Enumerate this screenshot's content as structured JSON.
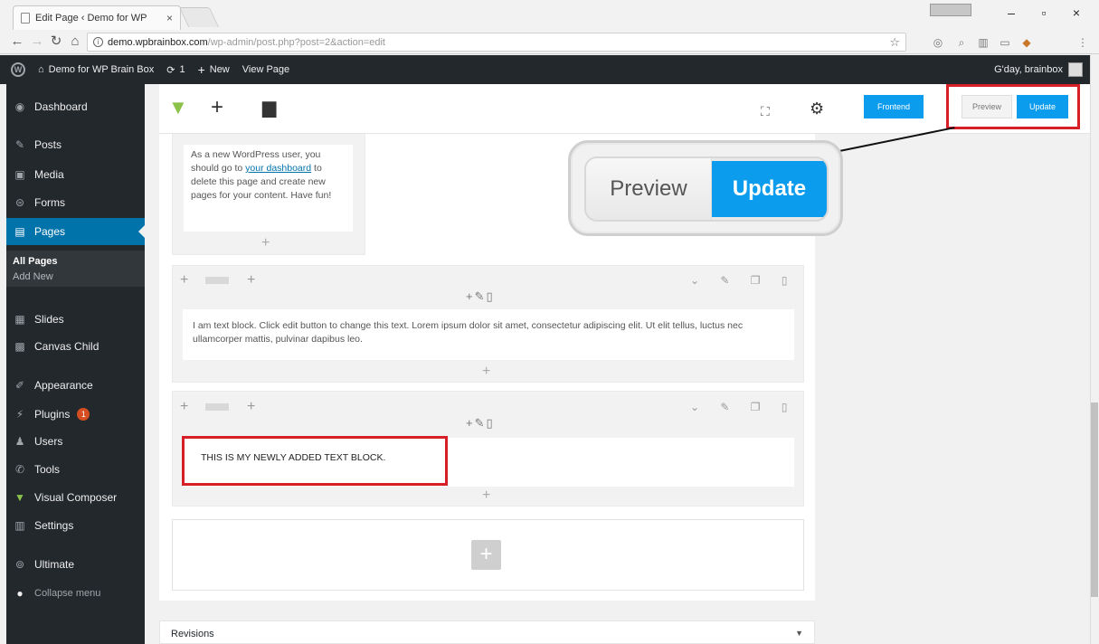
{
  "browser": {
    "tab_title": "Edit Page ‹ Demo for WP",
    "tab_close": "×",
    "url_host": "demo.wpbrainbox.com",
    "url_path": "/wp-admin/post.php?post=2&action=edit",
    "user_badge": "",
    "window_minimize": "–",
    "window_maximize": "▫",
    "window_close": "×"
  },
  "adminbar": {
    "site_name": "Demo for WP Brain Box",
    "updates_count": "1",
    "new_label": "New",
    "view_page": "View Page",
    "greeting": "G'day, brainbox"
  },
  "sidebar": {
    "items": [
      {
        "label": "Dashboard",
        "icon": "dashboard-icon"
      },
      {
        "label": "Posts",
        "icon": "pin-icon"
      },
      {
        "label": "Media",
        "icon": "media-icon"
      },
      {
        "label": "Forms",
        "icon": "forms-icon"
      },
      {
        "label": "Pages",
        "icon": "pages-icon"
      },
      {
        "label": "Slides",
        "icon": "slides-icon"
      },
      {
        "label": "Canvas Child",
        "icon": "canvas-icon"
      },
      {
        "label": "Appearance",
        "icon": "brush-icon"
      },
      {
        "label": "Plugins",
        "icon": "plug-icon",
        "badge": "1"
      },
      {
        "label": "Users",
        "icon": "users-icon"
      },
      {
        "label": "Tools",
        "icon": "wrench-icon"
      },
      {
        "label": "Visual Composer",
        "icon": "vc-icon"
      },
      {
        "label": "Settings",
        "icon": "settings-icon"
      },
      {
        "label": "Ultimate",
        "icon": "ultimate-icon"
      },
      {
        "label": "Collapse menu",
        "icon": "collapse-icon"
      }
    ],
    "submenu": {
      "all_pages": "All Pages",
      "add_new": "Add New"
    }
  },
  "vc_toolbar": {
    "frontend_label": "Frontend",
    "preview_label": "Preview",
    "update_label": "Update"
  },
  "callout": {
    "preview_label": "Preview",
    "update_label": "Update"
  },
  "editor": {
    "first_text": "As a new WordPress user, you should go to ",
    "first_link": "your dashboard",
    "first_text_after": " to delete this page and create new pages for your content. Have fun!",
    "second_text": "I am text block. Click edit button to change this text. Lorem ipsum dolor sit amet, consectetur adipiscing elit. Ut elit tellus, luctus nec ullamcorper mattis, pulvinar dapibus leo.",
    "third_text": "THIS IS MY NEWLY ADDED TEXT BLOCK.",
    "plus": "+",
    "column_controls": "+✎▯",
    "row_right_controls": "⌄ ✎ ❐ ▯"
  },
  "revisions": {
    "label": "Revisions",
    "caret": "▼"
  },
  "colors": {
    "accent": "#0c9ced",
    "highlight": "#d61f26",
    "admin_dark": "#23282d",
    "active_blue": "#0073aa"
  }
}
